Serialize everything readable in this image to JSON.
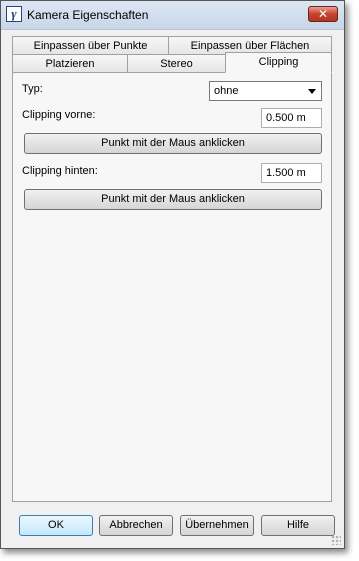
{
  "window": {
    "title": "Kamera Eigenschaften",
    "close_label": "✕"
  },
  "tabs_row1": [
    "Einpassen über Punkte",
    "Einpassen über Flächen"
  ],
  "tabs_row2": [
    "Platzieren",
    "Stereo",
    "Clipping"
  ],
  "active_tab": "Clipping",
  "clipping": {
    "typ_label": "Typ:",
    "typ_value": "ohne",
    "vorne_label": "Clipping vorne:",
    "vorne_value": "0.500 m",
    "vorne_button": "Punkt mit der Maus anklicken",
    "hinten_label": "Clipping hinten:",
    "hinten_value": "1.500 m",
    "hinten_button": "Punkt mit der Maus anklicken"
  },
  "buttons": {
    "ok": "OK",
    "cancel": "Abbrechen",
    "apply": "Übernehmen",
    "help": "Hilfe"
  },
  "icons": {
    "app": "app-logo-icon",
    "close": "close-icon",
    "dropdown": "chevron-down-icon"
  }
}
